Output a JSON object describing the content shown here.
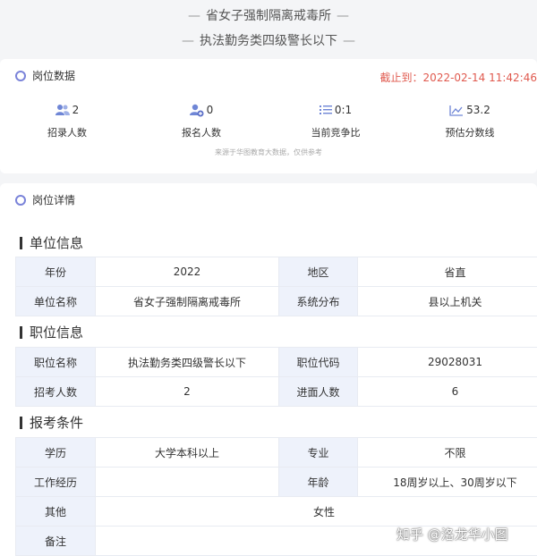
{
  "header": {
    "org_name": "省女子强制隔离戒毒所",
    "post_name": "执法勤务类四级警长以下",
    "dash": "—"
  },
  "stats_card": {
    "title": "岗位数据",
    "deadline": "截止到：2022-02-14 11:42:46",
    "items": [
      {
        "value": "2",
        "label": "招录人数",
        "icon": "people-icon"
      },
      {
        "value": "0",
        "label": "报名人数",
        "icon": "person-add-icon"
      },
      {
        "value": "0:1",
        "label": "当前竞争比",
        "icon": "list-icon"
      },
      {
        "value": "53.2",
        "label": "预估分数线",
        "icon": "trend-chart-icon"
      }
    ],
    "source_note": "来源于华图教育大数据，仅供参考"
  },
  "details_card": {
    "title": "岗位详情",
    "sections": [
      {
        "heading": "单位信息",
        "rows": [
          [
            "年份",
            "2022",
            "地区",
            "省直"
          ],
          [
            "单位名称",
            "省女子强制隔离戒毒所",
            "系统分布",
            "县以上机关"
          ]
        ]
      },
      {
        "heading": "职位信息",
        "rows": [
          [
            "职位名称",
            "执法勤务类四级警长以下",
            "职位代码",
            "29028031"
          ],
          [
            "招考人数",
            "2",
            "进面人数",
            "6"
          ]
        ]
      },
      {
        "heading": "报考条件",
        "rows": [
          [
            "学历",
            "大学本科以上",
            "专业",
            "不限"
          ],
          [
            "工作经历",
            "",
            "年龄",
            "18周岁以上、30周岁以下"
          ]
        ],
        "wide_rows": [
          [
            "其他",
            "女性"
          ],
          [
            "备注",
            ""
          ]
        ]
      }
    ]
  },
  "watermark": "知乎 @洛龙华小图",
  "colors": {
    "accent": "#7a83d9",
    "deadline": "#e05a4f",
    "key_cell_bg": "#eef2fb",
    "icon_blue": "#6f86d6"
  }
}
